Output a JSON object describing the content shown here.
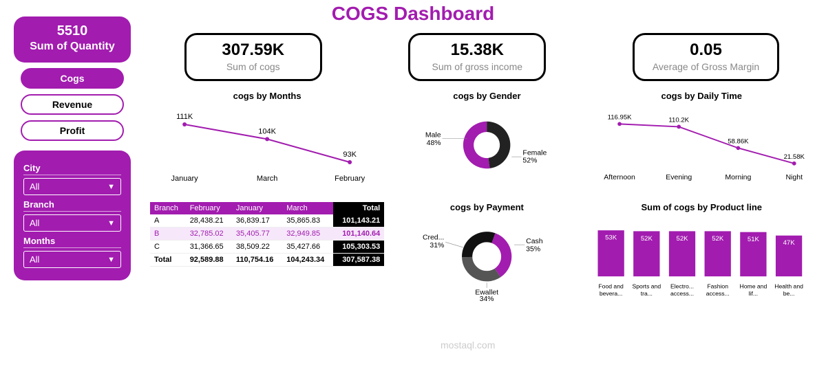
{
  "title": "COGS Dashboard",
  "sidebar": {
    "quantity": {
      "value": "5510",
      "label": "Sum of Quantity"
    },
    "nav": [
      {
        "label": "Cogs",
        "active": true
      },
      {
        "label": "Revenue",
        "active": false
      },
      {
        "label": "Profit",
        "active": false
      }
    ],
    "slicers": [
      {
        "label": "City",
        "value": "All"
      },
      {
        "label": "Branch",
        "value": "All"
      },
      {
        "label": "Months",
        "value": "All"
      }
    ]
  },
  "kpis": [
    {
      "value": "307.59K",
      "label": "Sum of cogs"
    },
    {
      "value": "15.38K",
      "label": "Sum of gross income"
    },
    {
      "value": "0.05",
      "label": "Average of Gross Margin"
    }
  ],
  "chart_data": [
    {
      "type": "line",
      "title": "cogs by Months",
      "categories": [
        "January",
        "March",
        "February"
      ],
      "values": [
        111,
        104,
        93
      ],
      "value_labels": [
        "111K",
        "104K",
        "93K"
      ]
    },
    {
      "type": "pie",
      "title": "cogs by Gender",
      "series": [
        {
          "name": "Male",
          "value": 48,
          "label": "Male\n48%"
        },
        {
          "name": "Female",
          "value": 52,
          "label": "Female\n52%"
        }
      ]
    },
    {
      "type": "line",
      "title": "cogs by Daily Time",
      "categories": [
        "Afternoon",
        "Evening",
        "Morning",
        "Night"
      ],
      "values": [
        116.95,
        110.2,
        58.86,
        21.58
      ],
      "value_labels": [
        "116.95K",
        "110.2K",
        "58.86K",
        "21.58K"
      ]
    },
    {
      "type": "table",
      "title": "Branch matrix",
      "columns": [
        "Branch",
        "February",
        "January",
        "March",
        "Total"
      ],
      "rows": [
        [
          "A",
          "28,438.21",
          "36,839.17",
          "35,865.83",
          "101,143.21"
        ],
        [
          "B",
          "32,785.02",
          "35,405.77",
          "32,949.85",
          "101,140.64"
        ],
        [
          "C",
          "31,366.65",
          "38,509.22",
          "35,427.66",
          "105,303.53"
        ],
        [
          "Total",
          "92,589.88",
          "110,754.16",
          "104,243.34",
          "307,587.38"
        ]
      ],
      "highlighted_row": 1
    },
    {
      "type": "pie",
      "title": "cogs by Payment",
      "series": [
        {
          "name": "Cash",
          "value": 35,
          "label": "Cash\n35%"
        },
        {
          "name": "Ewallet",
          "value": 34,
          "label": "Ewallet\n34%"
        },
        {
          "name": "Cred...",
          "value": 31,
          "label": "Cred...\n31%"
        }
      ]
    },
    {
      "type": "bar",
      "title": "Sum of cogs by Product line",
      "categories": [
        "Food and bevera...",
        "Sports and tra...",
        "Electro... access...",
        "Fashion access...",
        "Home and lif...",
        "Health and be..."
      ],
      "values": [
        53,
        52,
        52,
        52,
        51,
        47
      ],
      "value_labels": [
        "53K",
        "52K",
        "52K",
        "52K",
        "51K",
        "47K"
      ]
    }
  ],
  "watermark": "mostaql.com"
}
